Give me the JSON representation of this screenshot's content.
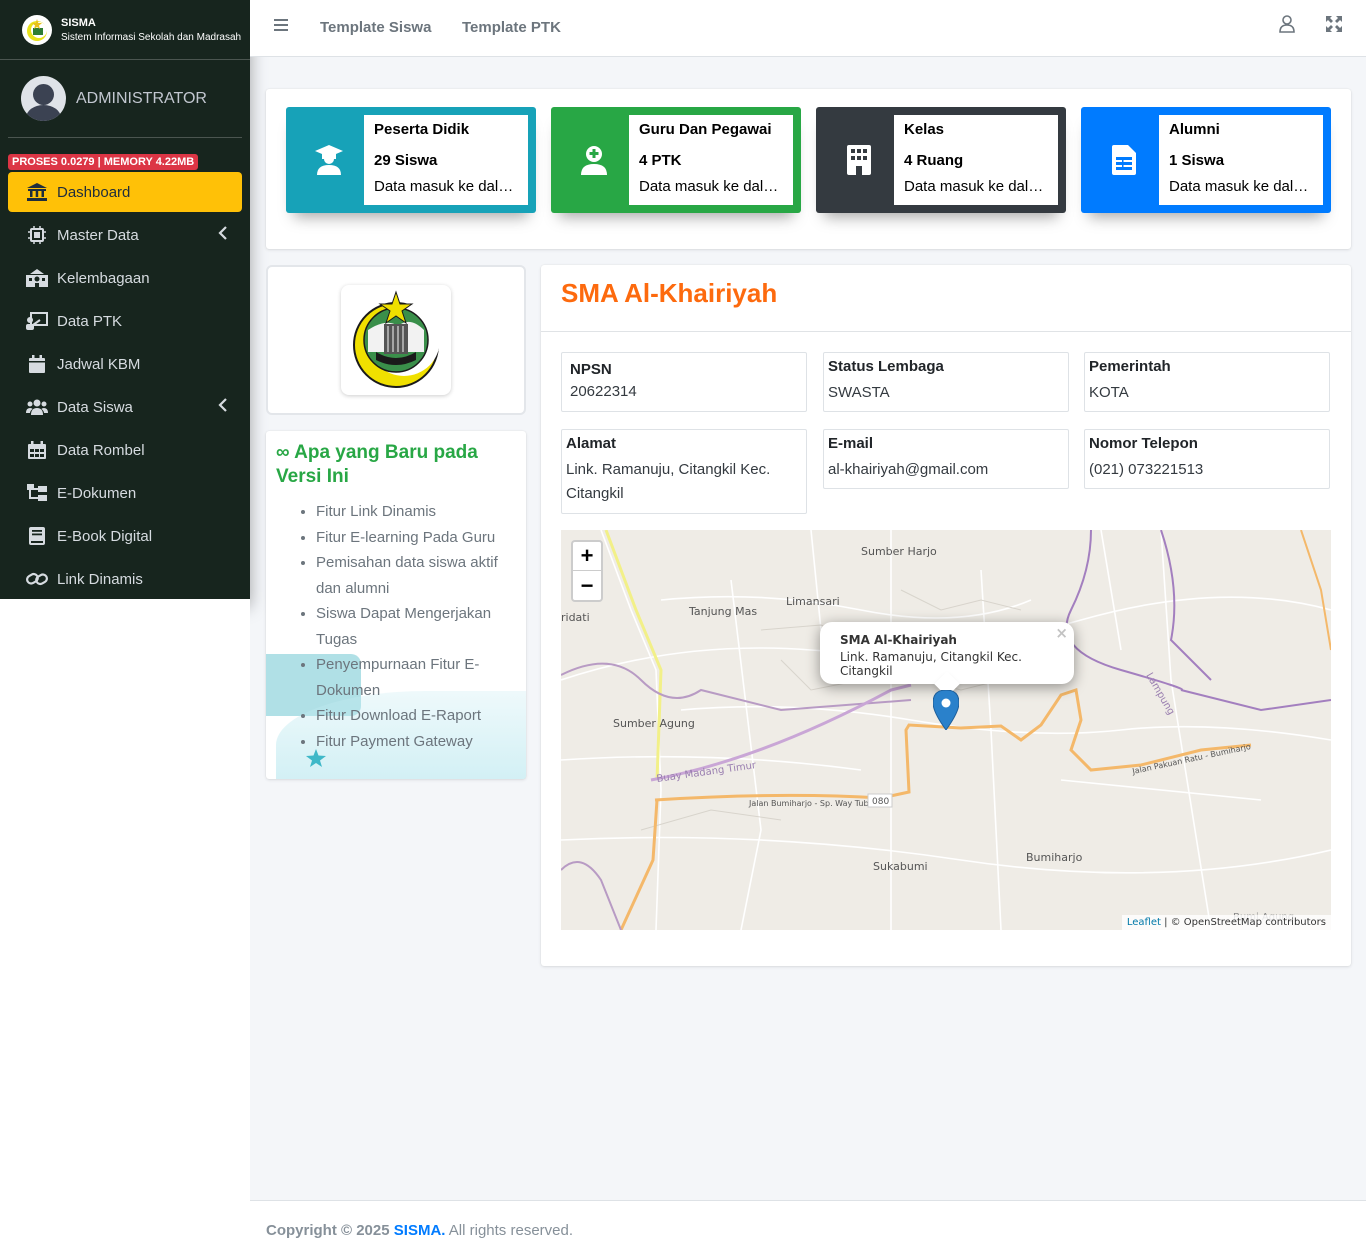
{
  "brand": {
    "title": "SISMA",
    "subtitle": "Sistem Informasi Sekolah dan Madrasah"
  },
  "user": {
    "name": "ADMINISTRATOR"
  },
  "debug_badge": "PROSES 0.0279 | MEMORY 4.22MB",
  "sidebar": {
    "items": [
      {
        "label": "Dashboard",
        "icon": "bank-icon",
        "active": true
      },
      {
        "label": "Master Data",
        "icon": "chip-icon",
        "has_children": true
      },
      {
        "label": "Kelembagaan",
        "icon": "school-building-icon"
      },
      {
        "label": "Data PTK",
        "icon": "chalkboard-teacher-icon"
      },
      {
        "label": "Jadwal KBM",
        "icon": "calendar-icon"
      },
      {
        "label": "Data Siswa",
        "icon": "users-icon",
        "has_children": true
      },
      {
        "label": "Data Rombel",
        "icon": "calendar-grid-icon"
      },
      {
        "label": "E-Dokumen",
        "icon": "folder-tree-icon"
      },
      {
        "label": "E-Book Digital",
        "icon": "book-icon"
      },
      {
        "label": "Link Dinamis",
        "icon": "link-icon"
      }
    ]
  },
  "topnav": {
    "links": [
      "Template Siswa",
      "Template PTK"
    ]
  },
  "stats": [
    {
      "title": "Peserta Didik",
      "count": "29 Siswa",
      "desc": "Data masuk ke dalam sistem",
      "color": "#17a2b8",
      "icon": "graduate-icon"
    },
    {
      "title": "Guru Dan Pegawai",
      "count": "4 PTK",
      "desc": "Data masuk ke dalam sistem",
      "color": "#28a745",
      "icon": "teacher-icon"
    },
    {
      "title": "Kelas",
      "count": "4 Ruang",
      "desc": "Data masuk ke dalam sistem",
      "color": "#343a40",
      "icon": "building-icon"
    },
    {
      "title": "Alumni",
      "count": "1 Siswa",
      "desc": "Data masuk ke dalam sistem",
      "color": "#007bff",
      "icon": "document-icon"
    }
  ],
  "whatsnew": {
    "title": "Apa yang Baru pada Versi Ini",
    "items": [
      "Fitur Link Dinamis",
      "Fitur E-learning Pada Guru",
      "Pemisahan data siswa aktif dan alumni",
      "Siswa Dapat Mengerjakan Tugas",
      "Penyempurnaan Fitur E-Dokumen",
      "Fitur Download E-Raport",
      "Fitur Payment Gateway"
    ]
  },
  "school": {
    "name": "SMA Al-Khairiyah",
    "fields": [
      {
        "label": "NPSN",
        "value": "20622314"
      },
      {
        "label": "Status Lembaga",
        "value": "SWASTA"
      },
      {
        "label": "Pemerintah",
        "value": "KOTA"
      },
      {
        "label": "Alamat",
        "value": "Link. Ramanuju, Citangkil Kec. Citangkil"
      },
      {
        "label": "E-mail",
        "value": "al-khairiyah@gmail.com"
      },
      {
        "label": "Nomor Telepon",
        "value": "(021) 073221513"
      }
    ]
  },
  "map": {
    "zoom_in": "+",
    "zoom_out": "−",
    "popup": {
      "title": "SMA Al-Khairiyah",
      "address": "Link. Ramanuju, Citangkil Kec. Citangkil",
      "close": "×"
    },
    "place_labels": [
      "Sumber Harjo",
      "Limansari",
      "Tanjung Mas",
      "ridati",
      "Sumber Agung",
      "Buay Madang Timur",
      "Jalan Bumiharjo - Sp. Way Tuba",
      "080",
      "Jalan Pakuan Ratu - Bumiharjo",
      "Lampung",
      "Sukabumi",
      "Bumiharjo",
      "Bumi Agung"
    ],
    "attribution_link": "Leaflet",
    "attribution_text": " | © OpenStreetMap contributors"
  },
  "footer": {
    "copyright": "Copyright © 2025",
    "brand": "SISMA.",
    "rest": " All rights reserved."
  }
}
